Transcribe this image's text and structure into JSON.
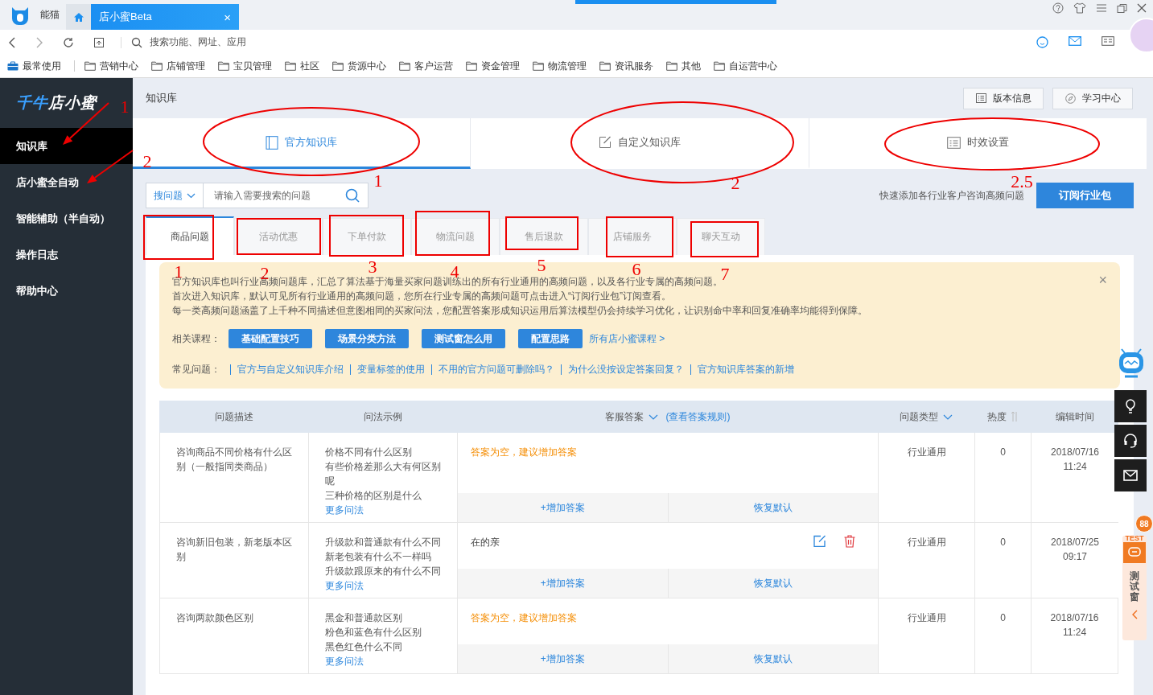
{
  "browser": {
    "app_name": "能猫",
    "tabs": [
      {
        "kind": "home",
        "selected": false
      },
      {
        "kind": "page",
        "label": "店小蜜Beta",
        "close": "×",
        "selected": true
      }
    ],
    "address_placeholder": "搜索功能、网址、应用",
    "bookmarks": [
      {
        "kind": "pinned",
        "label": "最常使用"
      },
      {
        "kind": "folder",
        "label": "营销中心"
      },
      {
        "kind": "folder",
        "label": "店铺管理"
      },
      {
        "kind": "folder",
        "label": "宝贝管理"
      },
      {
        "kind": "folder",
        "label": "社区"
      },
      {
        "kind": "folder",
        "label": "货源中心"
      },
      {
        "kind": "folder",
        "label": "客户运营"
      },
      {
        "kind": "folder",
        "label": "资金管理"
      },
      {
        "kind": "folder",
        "label": "物流管理"
      },
      {
        "kind": "folder",
        "label": "资讯服务"
      },
      {
        "kind": "folder",
        "label": "其他"
      },
      {
        "kind": "folder",
        "label": "自运营中心"
      }
    ]
  },
  "sidebar": {
    "logo_accent": "千牛",
    "logo_text": "店小蜜",
    "items": [
      {
        "label": "知识库",
        "selected": true
      },
      {
        "label": "店小蜜全自动",
        "selected": false
      },
      {
        "label": "智能辅助（半自动）",
        "selected": false
      },
      {
        "label": "操作日志",
        "selected": false
      },
      {
        "label": "帮助中心",
        "selected": false
      }
    ]
  },
  "header": {
    "title": "知识库",
    "buttons": [
      {
        "kind": "version",
        "label": "版本信息"
      },
      {
        "kind": "learn",
        "label": "学习中心"
      }
    ]
  },
  "kb_tabs": [
    {
      "label": "官方知识库",
      "selected": true
    },
    {
      "label": "自定义知识库",
      "selected": false
    },
    {
      "label": "时效设置",
      "selected": false
    }
  ],
  "search": {
    "scope": "搜问题",
    "placeholder": "请输入需要搜索的问题",
    "hint": "快速添加各行业客户咨询高频问题",
    "subscribe": "订阅行业包"
  },
  "categories": [
    {
      "label": "商品问题",
      "selected": true
    },
    {
      "label": "活动优惠",
      "selected": false
    },
    {
      "label": "下单付款",
      "selected": false
    },
    {
      "label": "物流问题",
      "selected": false
    },
    {
      "label": "售后退款",
      "selected": false
    },
    {
      "label": "店铺服务",
      "selected": false
    },
    {
      "label": "聊天互动",
      "selected": false
    }
  ],
  "notice": {
    "lines": [
      "官方知识库也叫行业高频问题库，汇总了算法基于海量买家问题训练出的所有行业通用的高频问题，以及各行业专属的高频问题。",
      "首次进入知识库，默认可见所有行业通用的高频问题，您所在行业专属的高频问题可点击进入“订阅行业包”订阅查看。",
      "每一类高频问题涵盖了上千种不同描述但意图相同的买家问法，您配置答案形成知识运用后算法模型仍会持续学习优化，让识别命中率和回复准确率均能得到保障。"
    ],
    "close": "×",
    "courses_label": "相关课程：",
    "courses": [
      "基础配置技巧",
      "场景分类方法",
      "测试窗怎么用",
      "配置思路"
    ],
    "all_courses": "所有店小蜜课程 >",
    "faq_label": "常见问题：",
    "faq": [
      "官方与自定义知识库介绍",
      "变量标签的使用",
      "不用的官方问题可删除吗？",
      "为什么没按设定答案回复？",
      "官方知识库答案的新增"
    ]
  },
  "table": {
    "columns": [
      {
        "kind": "plain",
        "label": "问题描述"
      },
      {
        "kind": "plain",
        "label": "问法示例"
      },
      {
        "kind": "answer",
        "label": "客服答案",
        "link": "(查看答案规则)"
      },
      {
        "kind": "filter",
        "label": "问题类型"
      },
      {
        "kind": "sort",
        "label": "热度"
      },
      {
        "kind": "plain",
        "label": "编辑时间"
      }
    ],
    "rows": [
      {
        "description": "咨询商品不同价格有什么区别（一般指同类商品）",
        "examples": [
          "价格不同有什么区别",
          "有些价格差那么大有何区别呢",
          "三种价格的区别是什么"
        ],
        "more": "更多问法",
        "answer": {
          "kind": "empty",
          "text": "答案为空，建议增加答案"
        },
        "add": "+增加答案",
        "reset": "恢复默认",
        "type": "行业通用",
        "heat": "0",
        "date": "2018/07/16",
        "time": "11:24"
      },
      {
        "description": "咨询新旧包装，新老版本区别",
        "examples": [
          "升级款和普通款有什么不同",
          "新老包装有什么不一样吗",
          "升级款跟原来的有什么不同"
        ],
        "more": "更多问法",
        "answer": {
          "kind": "text",
          "text": "在的亲"
        },
        "add": "+增加答案",
        "reset": "恢复默认",
        "type": "行业通用",
        "heat": "0",
        "date": "2018/07/25",
        "time": "09:17"
      },
      {
        "description": "咨询两款颜色区别",
        "examples": [
          "黑金和普通款区别",
          "粉色和蓝色有什么区别",
          "黑色红色什么不同"
        ],
        "more": "更多问法",
        "answer": {
          "kind": "empty",
          "text": "答案为空，建议增加答案"
        },
        "add": "+增加答案",
        "reset": "恢复默认",
        "type": "行业通用",
        "heat": "0",
        "date": "2018/07/16",
        "time": "11:24"
      }
    ]
  },
  "float_tools": {
    "badge": "TEST",
    "label": "测试窗",
    "count": "88"
  },
  "annotations": [
    "1",
    "2",
    "1",
    "2",
    "2.5",
    "1",
    "2",
    "3",
    "4",
    "5",
    "6",
    "7"
  ]
}
